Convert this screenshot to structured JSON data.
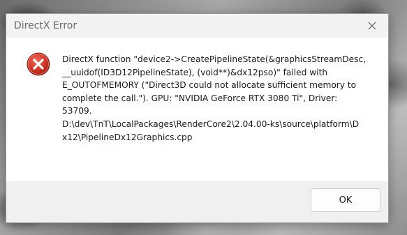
{
  "dialog": {
    "title": "DirectX Error",
    "message": "DirectX function \"device2->CreatePipelineState(&graphicsStreamDesc,\n__uuidof(ID3D12PipelineState), (void**)&dx12pso)\" failed with\nE_OUTOFMEMORY (\"Direct3D could not allocate sufficient memory to\ncomplete the call.\"). GPU: \"NVIDIA GeForce RTX 3080 Ti\", Driver:\n53709.\nD:\\dev\\TnT\\LocalPackages\\RenderCore2\\2.04.00-ks\\source\\platform\\D\nx12\\PipelineDx12Graphics.cpp",
    "ok_label": "OK",
    "icon": "error-icon",
    "close_icon": "close-icon"
  },
  "colors": {
    "error_red": "#c42b1c",
    "titlebar_bg": "#f3f3f3",
    "footer_bg": "#f0f0f0"
  }
}
